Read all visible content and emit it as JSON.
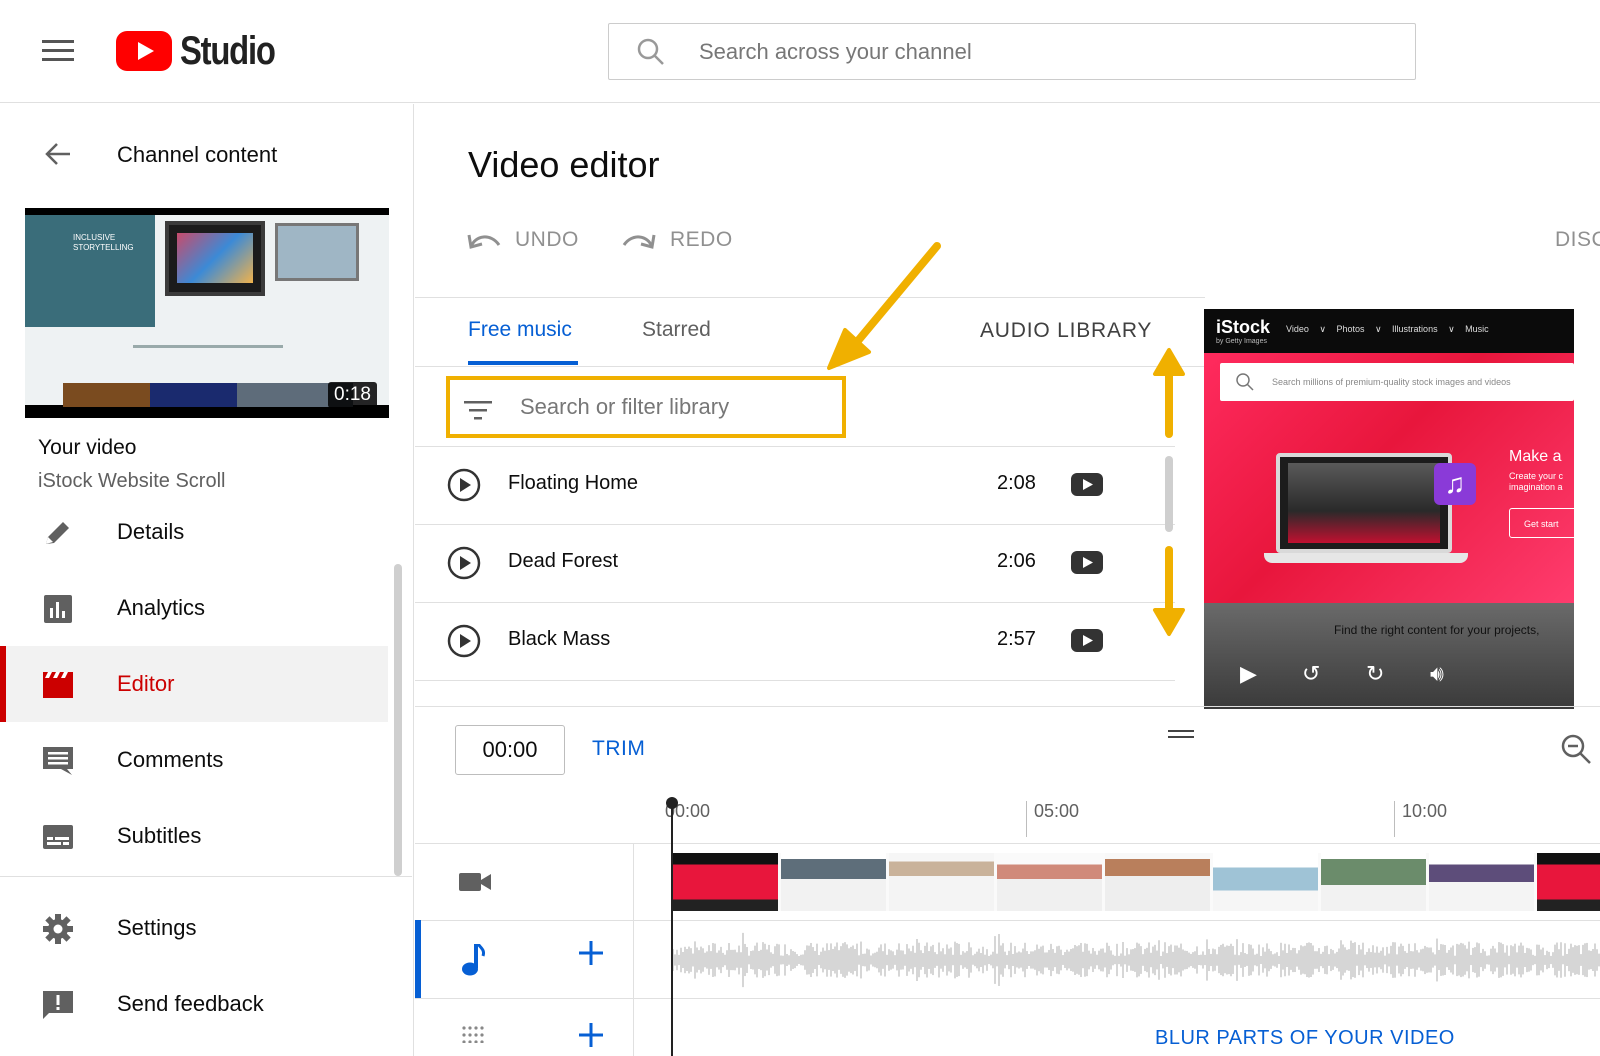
{
  "header": {
    "logo_text": "Studio",
    "search_placeholder": "Search across your channel"
  },
  "sidebar": {
    "back_label": "Channel content",
    "thumbnail_duration": "0:18",
    "thumbnail_text": "INCLUSIVE STORYTELLING",
    "your_video_label": "Your video",
    "video_title": "iStock Website Scroll",
    "items": [
      {
        "label": "Details",
        "icon": "pencil-icon"
      },
      {
        "label": "Analytics",
        "icon": "analytics-icon"
      },
      {
        "label": "Editor",
        "icon": "clapperboard-icon",
        "active": true
      },
      {
        "label": "Comments",
        "icon": "comment-icon"
      },
      {
        "label": "Subtitles",
        "icon": "subtitles-icon"
      }
    ],
    "bottom_items": [
      {
        "label": "Settings",
        "icon": "gear-icon"
      },
      {
        "label": "Send feedback",
        "icon": "feedback-icon"
      }
    ]
  },
  "editor": {
    "title": "Video editor",
    "undo_label": "UNDO",
    "redo_label": "REDO",
    "disc_label": "DISC",
    "tabs": [
      {
        "label": "Free music",
        "active": true
      },
      {
        "label": "Starred",
        "active": false
      }
    ],
    "audio_library_label": "AUDIO LIBRARY",
    "filter_placeholder": "Search or filter library",
    "tracks": [
      {
        "name": "Floating Home",
        "duration": "2:08"
      },
      {
        "name": "Dead Forest",
        "duration": "2:06"
      },
      {
        "name": "Black Mass",
        "duration": "2:57"
      }
    ]
  },
  "preview": {
    "logo": "iStock",
    "logo_sub": "by Getty Images",
    "menu": "Video ∨ Photos ∨ Illustrations ∨ Music",
    "search_text": "Search millions of premium-quality stock images and videos",
    "headline": "Make a",
    "subline": "Create your c imagination a",
    "cta": "Get start",
    "caption": "Find the right content for your projects,"
  },
  "timeline": {
    "current_time": "00:00",
    "trim_label": "TRIM",
    "ruler": [
      "00:00",
      "05:00",
      "10:00"
    ],
    "blur_label": "BLUR PARTS OF YOUR VIDEO"
  },
  "colors": {
    "accent_blue": "#065fd4",
    "active_red": "#cc0000",
    "highlight_yellow": "#f0b000"
  }
}
